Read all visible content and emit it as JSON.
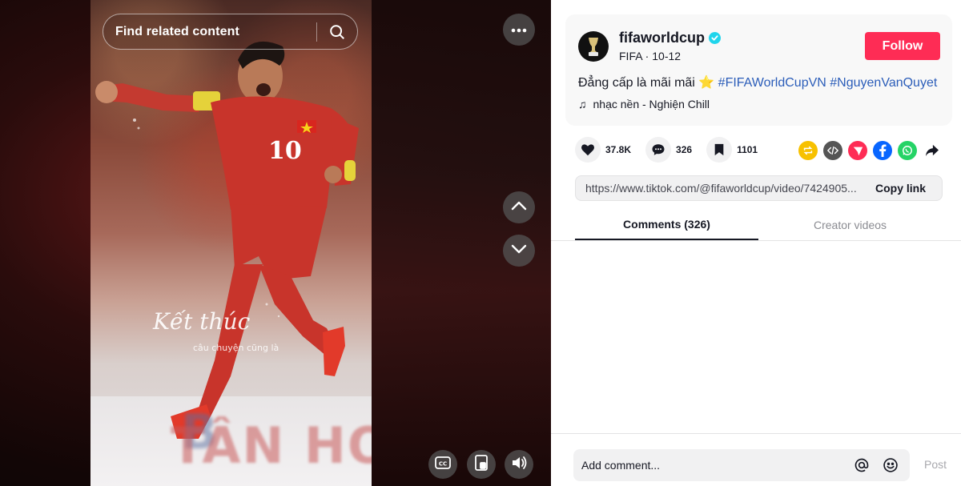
{
  "video": {
    "search_placeholder": "Find related content",
    "overlay_line1": "Kết thúc",
    "overlay_line2": "câu chuyện cũng là",
    "jersey_number": "10",
    "banner_text": "TÂN HOÀ",
    "banner_letter": "B",
    "icons": {
      "search": "search-icon",
      "more": "more-icon",
      "up": "chevron-up-icon",
      "down": "chevron-down-icon",
      "captions": "cc-icon",
      "pip": "picture-in-picture-icon",
      "volume": "volume-icon"
    }
  },
  "author": {
    "username": "fifaworldcup",
    "verified": true,
    "display_name": "FIFA",
    "date": "10-12",
    "separator": " · ",
    "follow_label": "Follow"
  },
  "post": {
    "caption_text": "Đẳng cấp là mãi mãi",
    "caption_emoji": "⭐",
    "hashtags": [
      "#FIFAWorldCupVN",
      "#NguyenVanQuyet"
    ],
    "music_icon": "♫",
    "music": "nhạc nền - Nghiện Chill"
  },
  "stats": {
    "likes": "37.8K",
    "comments": "326",
    "saves": "1101"
  },
  "share": {
    "url": "https://www.tiktok.com/@fifaworldcup/video/7424905...",
    "copy_label": "Copy link",
    "icons": [
      "repost-icon",
      "embed-icon",
      "send-icon",
      "facebook-icon",
      "whatsapp-icon",
      "share-arrow-icon"
    ],
    "colors": {
      "repost": "#f7c100",
      "embed": "#555555",
      "send": "#fe2c55",
      "facebook": "#0866ff",
      "whatsapp": "#25d366"
    }
  },
  "tabs": {
    "comments": "Comments (326)",
    "creator_videos": "Creator videos"
  },
  "comment_box": {
    "placeholder": "Add comment...",
    "post_label": "Post"
  },
  "colors": {
    "accent": "#fe2c55",
    "hashtag": "#2b5db9",
    "verified": "#20d5ec"
  }
}
